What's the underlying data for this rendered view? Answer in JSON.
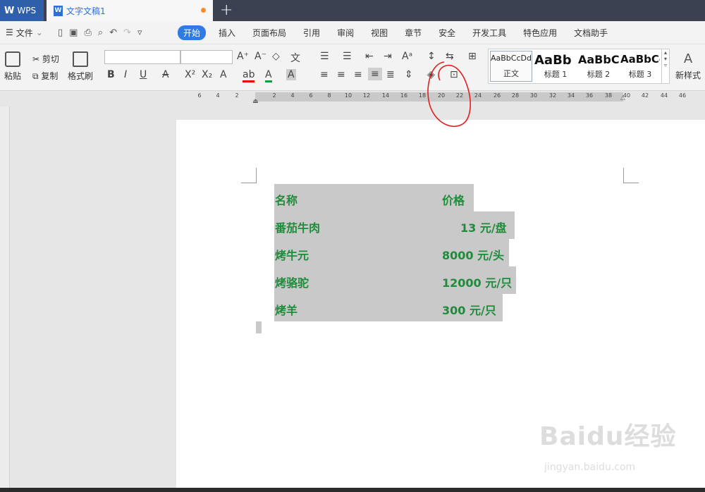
{
  "titlebar": {
    "app_tab": "WPS",
    "doc_tab": "文字文稿1",
    "new_tab": "+"
  },
  "menubar": {
    "file": "文件",
    "items": [
      "开始",
      "插入",
      "页面布局",
      "引用",
      "审阅",
      "视图",
      "章节",
      "安全",
      "开发工具",
      "特色应用",
      "文档助手"
    ],
    "active": "开始"
  },
  "ribbon": {
    "paste": "粘贴",
    "cut": "剪切",
    "copy": "复制",
    "format_painter": "格式刷",
    "styles": [
      {
        "sample": "AaBbCcDd",
        "name": "正文"
      },
      {
        "sample": "AaBb",
        "name": "标题 1"
      },
      {
        "sample": "AaBbC",
        "name": "标题 2"
      },
      {
        "sample": "AaBbCc",
        "name": "标题 3"
      }
    ],
    "new_style": "新样式"
  },
  "ruler": {
    "ticks": [
      "6",
      "4",
      "2",
      "2",
      "4",
      "6",
      "8",
      "10",
      "12",
      "14",
      "16",
      "18",
      "20",
      "22",
      "24",
      "26",
      "28",
      "30",
      "32",
      "34",
      "36",
      "38",
      "40",
      "42",
      "44",
      "46"
    ]
  },
  "table": {
    "rows": [
      {
        "name": "名称",
        "price": "价格"
      },
      {
        "name": "番茄牛肉",
        "price": "13 元/盘"
      },
      {
        "name": "烤牛元",
        "price": "8000 元/头"
      },
      {
        "name": "烤骆驼",
        "price": "12000 元/只"
      },
      {
        "name": "烤羊",
        "price": "300 元/只"
      }
    ]
  },
  "colors": {
    "text_green": "#1e8c3a",
    "shading": "#c9c9c9",
    "accent": "#2f7ae5",
    "annotation": "#e02020"
  },
  "watermark": {
    "brand": "Baidu经验",
    "url": "jingyan.baidu.com"
  }
}
